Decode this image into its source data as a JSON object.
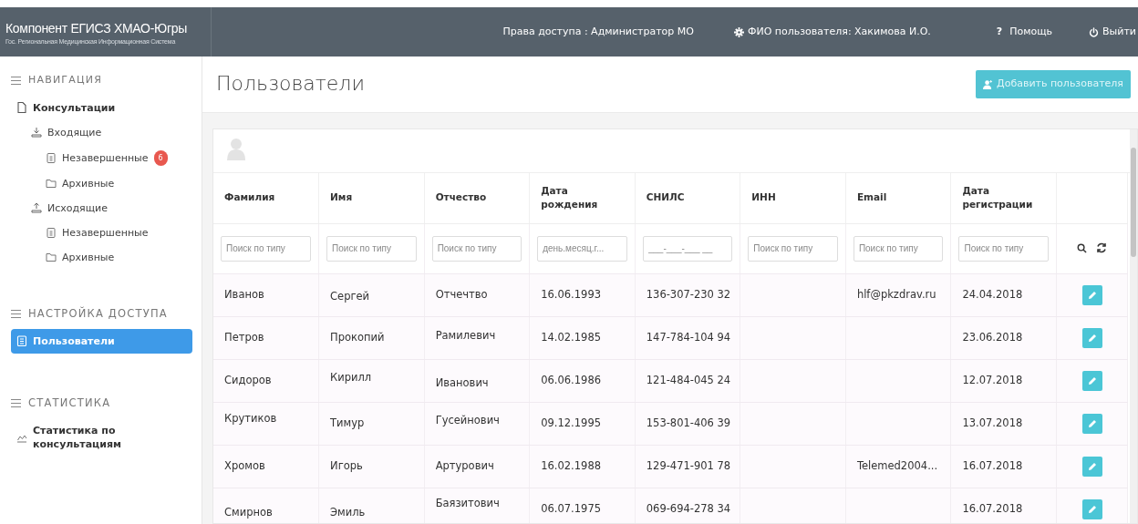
{
  "brand": {
    "title": "Компонент ЕГИСЗ ХМАО-Югры",
    "subtitle": "Гос. Региональная Медицинская Информационная Система"
  },
  "topbar": [
    {
      "kind": "text",
      "label": "Права доступа : Администратор МО"
    },
    {
      "kind": "gear",
      "label": "ФИО пользователя: Хакимова И.О."
    },
    {
      "kind": "glyph",
      "glyph": "?",
      "label": "Помощь"
    },
    {
      "kind": "power",
      "label": "Выйти"
    }
  ],
  "sidebar": {
    "sections": [
      {
        "title": "НАВИГАЦИЯ",
        "items": [
          {
            "label": "Консультации",
            "kind": "document",
            "selected": false,
            "children": [
              {
                "label": "Входящие",
                "kind": "incoming",
                "selected": false,
                "children": [
                  {
                    "label": "Незавершенные",
                    "kind": "pending",
                    "selected": false,
                    "badge": "6"
                  },
                  {
                    "label": "Архивные",
                    "kind": "archive",
                    "selected": false
                  }
                ]
              },
              {
                "label": "Исходящие",
                "kind": "outgoing",
                "selected": false,
                "children": [
                  {
                    "label": "Незавершенные",
                    "kind": "pending",
                    "selected": false
                  },
                  {
                    "label": "Архивные",
                    "kind": "archive",
                    "selected": false
                  }
                ]
              }
            ]
          }
        ]
      },
      {
        "title": "НАСТРОЙКА ДОСТУПА",
        "items": [
          {
            "label": "Пользователи",
            "kind": "userlist",
            "selected": true
          }
        ]
      },
      {
        "title": "СТАТИСТИКА",
        "items": [
          {
            "label": "Статистика по консультациям",
            "kind": "stats",
            "selected": false
          }
        ]
      }
    ]
  },
  "page": {
    "title": "Пользователи",
    "add_button": "Добавить пользователя"
  },
  "table": {
    "columns": [
      "Фамилия",
      "Имя",
      "Отчество",
      "Дата рождения",
      "СНИЛС",
      "ИНН",
      "Email",
      "Дата регистрации",
      ""
    ],
    "filters": [
      {
        "placeholder": "Поиск по типу"
      },
      {
        "placeholder": "Поиск по типу"
      },
      {
        "placeholder": "Поиск по типу"
      },
      {
        "placeholder": "день.месяц.г..."
      },
      {
        "placeholder": "___-___-___ __"
      },
      {
        "placeholder": "Поиск по типу"
      },
      {
        "placeholder": "Поиск по типу"
      },
      {
        "placeholder": "Поиск по типу"
      }
    ],
    "rows": [
      [
        "Иванов",
        "Сергей",
        "Отчечтво",
        "16.06.1993",
        "136-307-230 32",
        "",
        "hlf@pkzdrav.ru",
        "24.04.2018"
      ],
      [
        "Петров",
        "Прокопий",
        "Рамилевич",
        "14.02.1985",
        "147-784-104 94",
        "",
        "",
        "23.06.2018"
      ],
      [
        "Сидоров",
        "Кирилл",
        "Иванович",
        "06.06.1986",
        "121-484-045 24",
        "",
        "",
        "12.07.2018"
      ],
      [
        "Крутиков",
        "Тимур",
        "Гусейнович",
        "09.12.1995",
        "153-801-406 39",
        "",
        "",
        "13.07.2018"
      ],
      [
        "Хромов",
        "Игорь",
        "Артурович",
        "16.02.1988",
        "129-471-901 78",
        "",
        "Telemed2004...",
        "16.07.2018"
      ],
      [
        "Смирнов",
        "Эмиль",
        "Баязитович",
        "06.07.1975",
        "069-694-278 34",
        "",
        "",
        "16.07.2018"
      ]
    ]
  }
}
